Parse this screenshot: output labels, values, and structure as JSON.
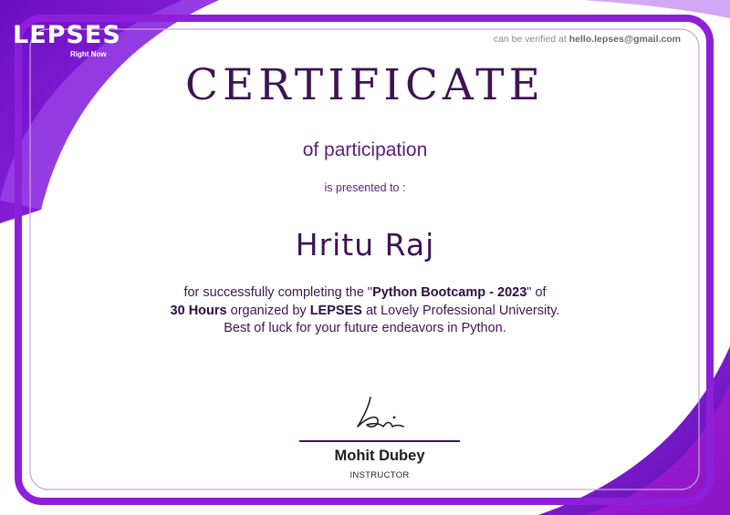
{
  "brand": {
    "logo_text": "LEPSES",
    "tagline": "Right Now"
  },
  "verification": {
    "prefix": "can be verified at",
    "email": "hello.lepses@gmail.com"
  },
  "certificate": {
    "title": "CERTIFICATE",
    "subtitle": "of participation",
    "presented_to": "is presented to :",
    "recipient": "Hritu Raj",
    "body": {
      "line1_before": "for successfully completing the \"",
      "program": "Python Bootcamp - 2023",
      "line1_after": "\"  of",
      "duration": "30 Hours",
      "line2_mid": " organized by ",
      "organizer": "LEPSES",
      "line2_after": " at Lovely Professional University.",
      "line3": "Best of luck for your future endeavors in Python."
    }
  },
  "signatory": {
    "name": "Mohit Dubey",
    "role": "INSTRUCTOR"
  },
  "colors": {
    "accent_purple": "#7b16d8",
    "dark_purple": "#3d1454",
    "magenta": "#b21cd6",
    "border": "#c7a6dc"
  }
}
